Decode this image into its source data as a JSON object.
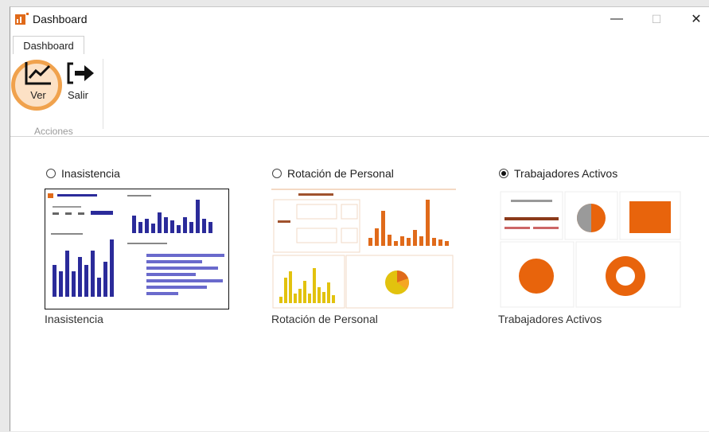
{
  "window": {
    "title": "Dashboard",
    "controls": {
      "minimize": "—",
      "maximize": "☐",
      "close": "✕"
    },
    "app_icon": "dashboard-app-icon"
  },
  "ribbon": {
    "tabs": [
      {
        "label": "Dashboard",
        "active": true
      }
    ],
    "buttons": [
      {
        "label": "Ver",
        "icon": "line-chart-icon",
        "highlighted": true
      },
      {
        "label": "Salir",
        "icon": "exit-icon"
      }
    ],
    "group_label": "Acciones"
  },
  "options": [
    {
      "label": "Inasistencia",
      "checked": false,
      "caption": "Inasistencia",
      "theme": "#2b2b9a"
    },
    {
      "label": "Rotación de Personal",
      "checked": false,
      "caption": "Rotación de Personal",
      "theme": "#e06a1a"
    },
    {
      "label": "Trabajadores Activos",
      "checked": true,
      "caption": "Trabajadores Activos",
      "theme": "#e8640c"
    }
  ],
  "colors": {
    "highlight": "#f0a24d",
    "inasistencia": "#2b2b9a",
    "rotacion": "#e06a1a",
    "rotacion_alt": "#e2c20e",
    "activos": "#e8640c"
  }
}
